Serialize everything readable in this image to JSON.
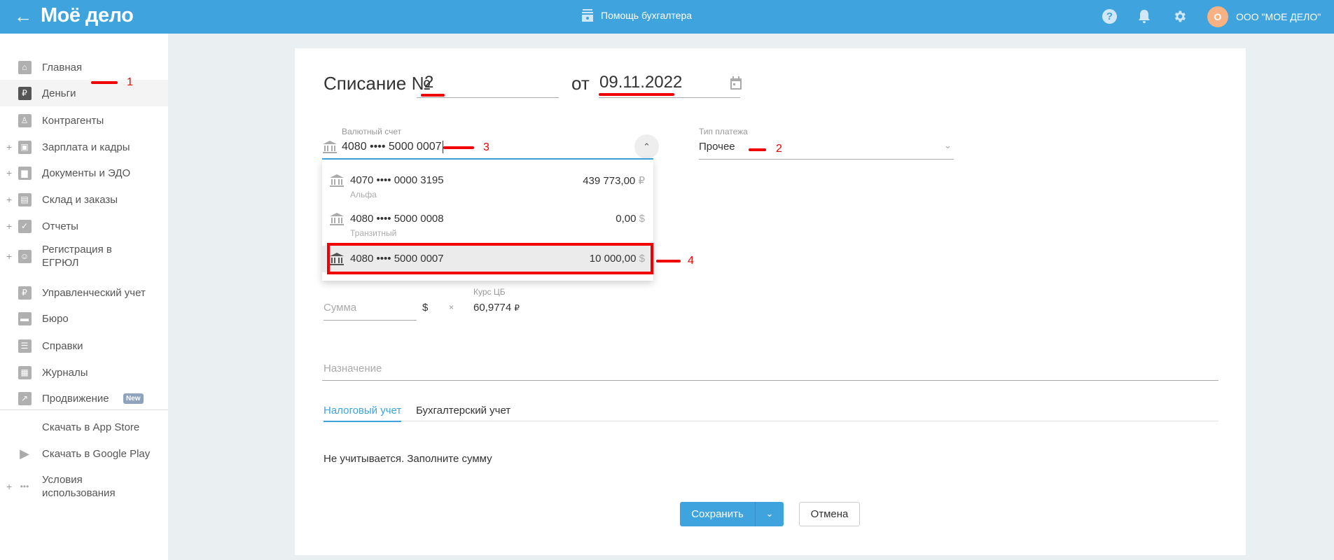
{
  "header": {
    "logo": "Моё дело",
    "help_center": "Помощь бухгалтера",
    "org_avatar": "О",
    "org_name": "ООО \"МОЕ ДЕЛО\""
  },
  "sidebar": {
    "items": [
      {
        "label": "Главная",
        "icon": "home-icon",
        "plus": false
      },
      {
        "label": "Деньги",
        "icon": "money-icon",
        "plus": false,
        "active": true
      },
      {
        "label": "Контрагенты",
        "icon": "contractor-icon",
        "plus": false
      },
      {
        "label": "Зарплата и кадры",
        "icon": "wallet-icon",
        "plus": true
      },
      {
        "label": "Документы и ЭДО",
        "icon": "folder-icon",
        "plus": true
      },
      {
        "label": "Склад и заказы",
        "icon": "warehouse-icon",
        "plus": true
      },
      {
        "label": "Отчеты",
        "icon": "report-icon",
        "plus": true
      },
      {
        "label": "Регистрация в ЕГРЮЛ",
        "icon": "registration-icon",
        "plus": true
      },
      {
        "label": "Управленческий учет",
        "icon": "management-icon",
        "plus": false
      },
      {
        "label": "Бюро",
        "icon": "briefcase-icon",
        "plus": false
      },
      {
        "label": "Справки",
        "icon": "reference-icon",
        "plus": false
      },
      {
        "label": "Журналы",
        "icon": "journal-icon",
        "plus": false
      },
      {
        "label": "Продвижение",
        "icon": "chart-icon",
        "plus": false,
        "badge": "New"
      }
    ],
    "bottom_items": [
      {
        "label": "Скачать в App Store",
        "icon": "apple-icon"
      },
      {
        "label": "Скачать в Google Play",
        "icon": "google-play-icon"
      },
      {
        "label": "Условия использования",
        "icon": "more-icon"
      }
    ]
  },
  "form": {
    "title": "Списание №",
    "number": "2",
    "date_prefix": "от",
    "date": "09.11.2022",
    "account_label": "Валютный счет",
    "account_value": "4080 •••• 5000 0007",
    "payment_type_label": "Тип платежа",
    "payment_type_value": "Прочее",
    "dropdown": [
      {
        "account": "4070 •••• 0000 3195",
        "bank": "Альфа",
        "amount": "439 773,00",
        "currency": "₽"
      },
      {
        "account": "4080 •••• 5000 0008",
        "bank": "Транзитный",
        "amount": "0,00",
        "currency": "$"
      },
      {
        "account": "4080 •••• 5000 0007",
        "bank": "",
        "amount": "10 000,00",
        "currency": "$",
        "selected": true
      }
    ],
    "sum_placeholder": "Сумма",
    "sum_currency": "$",
    "multiply": "×",
    "rate_label": "Курс ЦБ",
    "rate_value": "60,9774",
    "rate_currency": "₽",
    "purpose_placeholder": "Назначение",
    "tabs": [
      "Налоговый учет",
      "Бухгалтерский учет"
    ],
    "tax_note": "Не учитывается. Заполните сумму",
    "save": "Сохранить",
    "cancel": "Отмена"
  },
  "annotations": [
    "1",
    "2",
    "3",
    "4"
  ],
  "colors": {
    "header": "#3fa3de",
    "accent": "#3fa3de",
    "annotation": "#f00000",
    "avatar": "#f7b183"
  }
}
